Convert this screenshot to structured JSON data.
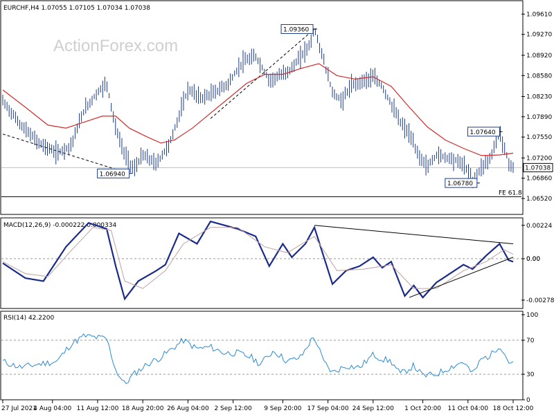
{
  "chart_data": [
    {
      "type": "bar",
      "subtype": "ohlc",
      "header": "EURCHF,H4  1.07055 1.07105 1.07034 1.07038",
      "watermark": "ActionForex.com",
      "colors": {
        "bars": "#1a3a8a",
        "ma": "#d42a2a",
        "price_line": "#bfbfbf",
        "trendline": "#000000"
      },
      "ylim": [
        1.063,
        1.098
      ],
      "y_ticks": [
        1.0961,
        1.0927,
        1.0892,
        1.0858,
        1.0823,
        1.0789,
        1.0755,
        1.072,
        1.0686,
        1.0652
      ],
      "y_tick_labels": [
        "1.09610",
        "1.09270",
        "1.08920",
        "1.08580",
        "1.08230",
        "1.07890",
        "1.07550",
        "1.07200",
        "1.06860",
        "1.06520"
      ],
      "current_price": 1.07038,
      "current_price_label": "1.07038",
      "fe_label": "FE 61.8",
      "fe_level": 1.0655,
      "annotations": [
        {
          "label": "1.06940",
          "x": 28,
          "y": 1.0694
        },
        {
          "label": "1.09360",
          "x": 69,
          "y": 1.0936
        },
        {
          "label": "1.06780",
          "x": 105,
          "y": 1.0678
        },
        {
          "label": "1.07640",
          "x": 110,
          "y": 1.0764
        }
      ],
      "trendlines": [
        {
          "x1": 0,
          "y1": 1.076,
          "x2": 28,
          "y2": 1.0694,
          "dashed": true
        },
        {
          "x1": 46,
          "y1": 1.0786,
          "x2": 69,
          "y2": 1.0936,
          "dashed": true
        }
      ],
      "price_path": [
        [
          0,
          1.0815
        ],
        [
          4,
          1.0775
        ],
        [
          8,
          1.0745
        ],
        [
          12,
          1.0728
        ],
        [
          15,
          1.074
        ],
        [
          18,
          1.08
        ],
        [
          21,
          1.083
        ],
        [
          23,
          1.0845
        ],
        [
          25,
          1.077
        ],
        [
          27,
          1.0725
        ],
        [
          29,
          1.07
        ],
        [
          31,
          1.0725
        ],
        [
          34,
          1.071
        ],
        [
          37,
          1.0745
        ],
        [
          39,
          1.079
        ],
        [
          41,
          1.0835
        ],
        [
          44,
          1.082
        ],
        [
          47,
          1.083
        ],
        [
          50,
          1.0845
        ],
        [
          53,
          1.088
        ],
        [
          56,
          1.089
        ],
        [
          59,
          1.085
        ],
        [
          62,
          1.086
        ],
        [
          64,
          1.087
        ],
        [
          66,
          1.089
        ],
        [
          68,
          1.091
        ],
        [
          69,
          1.0936
        ],
        [
          71,
          1.0885
        ],
        [
          73,
          1.083
        ],
        [
          75,
          1.0815
        ],
        [
          77,
          1.084
        ],
        [
          80,
          1.085
        ],
        [
          82,
          1.0855
        ],
        [
          84,
          1.084
        ],
        [
          86,
          1.081
        ],
        [
          88,
          1.078
        ],
        [
          90,
          1.076
        ],
        [
          92,
          1.0725
        ],
        [
          94,
          1.0705
        ],
        [
          96,
          1.0725
        ],
        [
          99,
          1.072
        ],
        [
          102,
          1.071
        ],
        [
          104,
          1.068
        ],
        [
          106,
          1.0705
        ],
        [
          108,
          1.072
        ],
        [
          110,
          1.0764
        ],
        [
          112,
          1.0712
        ],
        [
          113,
          1.07038
        ]
      ],
      "ma_path": [
        [
          0,
          1.0834
        ],
        [
          5,
          1.0805
        ],
        [
          10,
          1.0775
        ],
        [
          14,
          1.077
        ],
        [
          18,
          1.078
        ],
        [
          22,
          1.079
        ],
        [
          25,
          1.079
        ],
        [
          28,
          1.077
        ],
        [
          32,
          1.0755
        ],
        [
          35,
          1.0745
        ],
        [
          38,
          1.075
        ],
        [
          42,
          1.077
        ],
        [
          46,
          1.0795
        ],
        [
          50,
          1.082
        ],
        [
          54,
          1.0845
        ],
        [
          58,
          1.086
        ],
        [
          62,
          1.086
        ],
        [
          66,
          1.087
        ],
        [
          70,
          1.0878
        ],
        [
          74,
          1.0858
        ],
        [
          78,
          1.0852
        ],
        [
          82,
          1.0856
        ],
        [
          86,
          1.084
        ],
        [
          90,
          1.0805
        ],
        [
          94,
          1.0772
        ],
        [
          98,
          1.075
        ],
        [
          102,
          1.0736
        ],
        [
          106,
          1.0724
        ],
        [
          110,
          1.0725
        ],
        [
          113,
          1.0728
        ]
      ],
      "xlim": [
        0,
        113
      ]
    },
    {
      "type": "line",
      "header": "MACD(12,26,9) -0.000222 0.000334",
      "ylim": [
        -0.0032,
        0.0026
      ],
      "y_ticks": [
        0.00224,
        0.0,
        -0.00278
      ],
      "y_tick_labels": [
        "0.00224",
        "0.00",
        "-0.002785"
      ],
      "zero_labels": [
        "0.00",
        "0.00"
      ],
      "zero_line": 0.0,
      "colors": {
        "macd": "#1a2a8a",
        "signal": "#c0a0a0",
        "trendline": "#000000"
      },
      "series": [
        {
          "role": "macd",
          "values": [
            [
              0,
              -0.0003
            ],
            [
              5,
              -0.0013
            ],
            [
              9,
              -0.0015
            ],
            [
              14,
              0.0008
            ],
            [
              19,
              0.0024
            ],
            [
              23,
              0.002
            ],
            [
              25,
              -0.0005
            ],
            [
              27,
              -0.0027
            ],
            [
              30,
              -0.0015
            ],
            [
              34,
              -0.0008
            ],
            [
              36,
              -0.0004
            ],
            [
              39,
              0.0017
            ],
            [
              43,
              0.001
            ],
            [
              46,
              0.0025
            ],
            [
              52,
              0.002
            ],
            [
              56,
              0.0015
            ],
            [
              59,
              -0.0005
            ],
            [
              62,
              0.001
            ],
            [
              64,
              0.0001
            ],
            [
              67,
              0.001
            ],
            [
              69,
              0.0021
            ],
            [
              73,
              -0.0017
            ],
            [
              76,
              -0.0008
            ],
            [
              79,
              -0.0005
            ],
            [
              82,
              0.0001
            ],
            [
              84,
              -0.0006
            ],
            [
              86,
              -0.0002
            ],
            [
              89,
              -0.0025
            ],
            [
              91,
              -0.0018
            ],
            [
              93,
              -0.0026
            ],
            [
              96,
              -0.0016
            ],
            [
              99,
              -0.001
            ],
            [
              102,
              -0.0004
            ],
            [
              104,
              -0.0007
            ],
            [
              107,
              0.0002
            ],
            [
              110,
              0.001
            ],
            [
              112,
              -0.0001
            ],
            [
              113,
              -0.0002
            ]
          ]
        },
        {
          "role": "signal",
          "values": [
            [
              0,
              -0.0002
            ],
            [
              5,
              -0.001
            ],
            [
              10,
              -0.0012
            ],
            [
              15,
              0.0005
            ],
            [
              20,
              0.0021
            ],
            [
              24,
              0.0019
            ],
            [
              27,
              -0.0015
            ],
            [
              31,
              -0.002
            ],
            [
              36,
              -0.0008
            ],
            [
              40,
              0.001
            ],
            [
              46,
              0.0021
            ],
            [
              52,
              0.0021
            ],
            [
              58,
              0.0008
            ],
            [
              63,
              0.0004
            ],
            [
              69,
              0.0015
            ],
            [
              74,
              -0.0008
            ],
            [
              80,
              -0.0007
            ],
            [
              86,
              -0.0004
            ],
            [
              91,
              -0.002
            ],
            [
              96,
              -0.002
            ],
            [
              102,
              -0.0008
            ],
            [
              107,
              -0.0002
            ],
            [
              111,
              0.0006
            ],
            [
              113,
              0.0003
            ]
          ]
        }
      ],
      "trendlines": [
        {
          "x1": 69,
          "y1": 0.00224,
          "x2": 113,
          "y2": 0.001
        },
        {
          "x1": 90,
          "y1": -0.0026,
          "x2": 113,
          "y2": 0.0001
        }
      ],
      "xlim": [
        0,
        113
      ]
    },
    {
      "type": "line",
      "header": "RSI(14) 42.2200",
      "ylim": [
        0,
        100
      ],
      "y_ticks": [
        100,
        70,
        30,
        0
      ],
      "y_tick_labels": [
        "100",
        "70",
        "30",
        "0"
      ],
      "levels": [
        70,
        30
      ],
      "colors": {
        "rsi": "#2a8ad4"
      },
      "series": [
        {
          "role": "rsi",
          "values": [
            [
              0,
              45
            ],
            [
              4,
              38
            ],
            [
              8,
              42
            ],
            [
              12,
              45
            ],
            [
              15,
              65
            ],
            [
              18,
              75
            ],
            [
              21,
              73
            ],
            [
              23,
              72
            ],
            [
              25,
              35
            ],
            [
              27,
              18
            ],
            [
              29,
              30
            ],
            [
              32,
              42
            ],
            [
              35,
              50
            ],
            [
              38,
              62
            ],
            [
              40,
              70
            ],
            [
              43,
              60
            ],
            [
              46,
              62
            ],
            [
              49,
              55
            ],
            [
              52,
              55
            ],
            [
              55,
              50
            ],
            [
              57,
              42
            ],
            [
              60,
              58
            ],
            [
              63,
              45
            ],
            [
              66,
              50
            ],
            [
              68,
              68
            ],
            [
              69,
              74
            ],
            [
              71,
              45
            ],
            [
              73,
              32
            ],
            [
              76,
              40
            ],
            [
              79,
              38
            ],
            [
              82,
              53
            ],
            [
              84,
              48
            ],
            [
              86,
              45
            ],
            [
              88,
              30
            ],
            [
              91,
              40
            ],
            [
              93,
              28
            ],
            [
              96,
              30
            ],
            [
              99,
              38
            ],
            [
              102,
              45
            ],
            [
              104,
              30
            ],
            [
              106,
              48
            ],
            [
              108,
              52
            ],
            [
              110,
              65
            ],
            [
              112,
              45
            ],
            [
              113,
              42
            ]
          ]
        }
      ],
      "xlim": [
        0,
        113
      ]
    }
  ],
  "x_axis": {
    "tick_labels": [
      "27 Jul 2021",
      "4 Aug 04:00",
      "11 Aug 12:00",
      "18 Aug 20:00",
      "26 Aug 04:00",
      "2 Sep 12:00",
      "9 Sep 20:00",
      "17 Sep 04:00",
      "24 Sep 12:00",
      "1 Oct 20:00",
      "11 Oct 04:00",
      "18 Oct 12:00"
    ],
    "tick_positions": [
      0,
      11,
      21,
      31,
      41,
      51,
      62,
      72,
      82,
      93,
      103,
      113
    ]
  }
}
